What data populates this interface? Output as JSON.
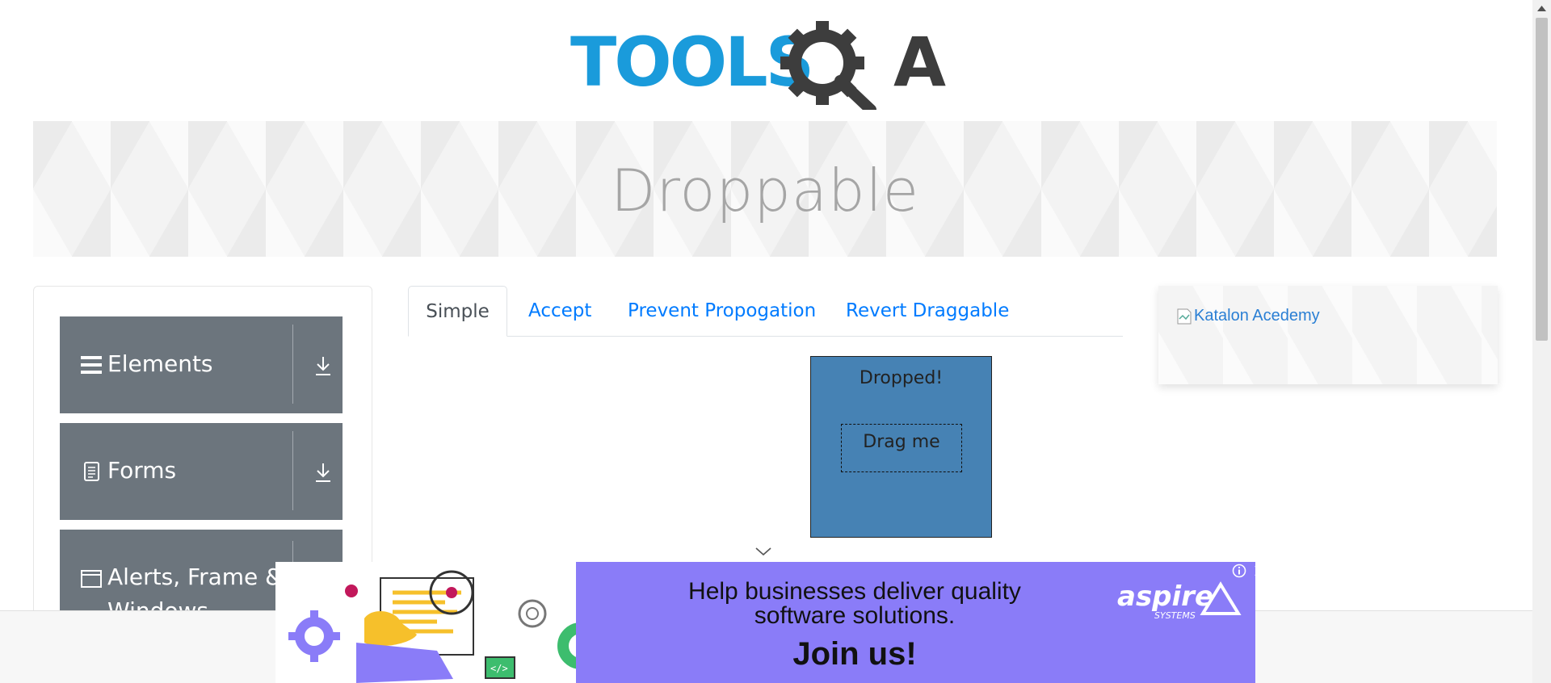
{
  "header": {
    "logo_alt": "TOOLSQA",
    "logo_text_left": "TOOLS",
    "logo_text_right": "A"
  },
  "banner": {
    "title": "Droppable"
  },
  "sidebar": {
    "groups": [
      {
        "label": "Elements",
        "icon": "hamburger-icon"
      },
      {
        "label": "Forms",
        "icon": "document-icon"
      },
      {
        "label": "Alerts, Frame &",
        "label_line2": "Windows",
        "icon": "window-icon"
      }
    ]
  },
  "tabs": [
    {
      "label": "Simple",
      "active": true
    },
    {
      "label": "Accept",
      "active": false
    },
    {
      "label": "Prevent Propogation",
      "active": false
    },
    {
      "label": "Revert Draggable",
      "active": false
    }
  ],
  "droppable": {
    "text": "Dropped!",
    "color": "#4682b4"
  },
  "draggable": {
    "text": "Drag me"
  },
  "right_ad": {
    "alt_text": "Katalon Acedemy"
  },
  "bottom_ad": {
    "headline_line1": "Help businesses deliver quality",
    "headline_line2": "software solutions.",
    "cta": "Join us!",
    "brand": "aspire",
    "brand_sub": "SYSTEMS",
    "background": "#8a7cf8"
  },
  "colors": {
    "link": "#007bff",
    "nav_bg": "#6c757d",
    "logo_blue": "#1a9bdb",
    "logo_dark": "#3d3d3d"
  }
}
